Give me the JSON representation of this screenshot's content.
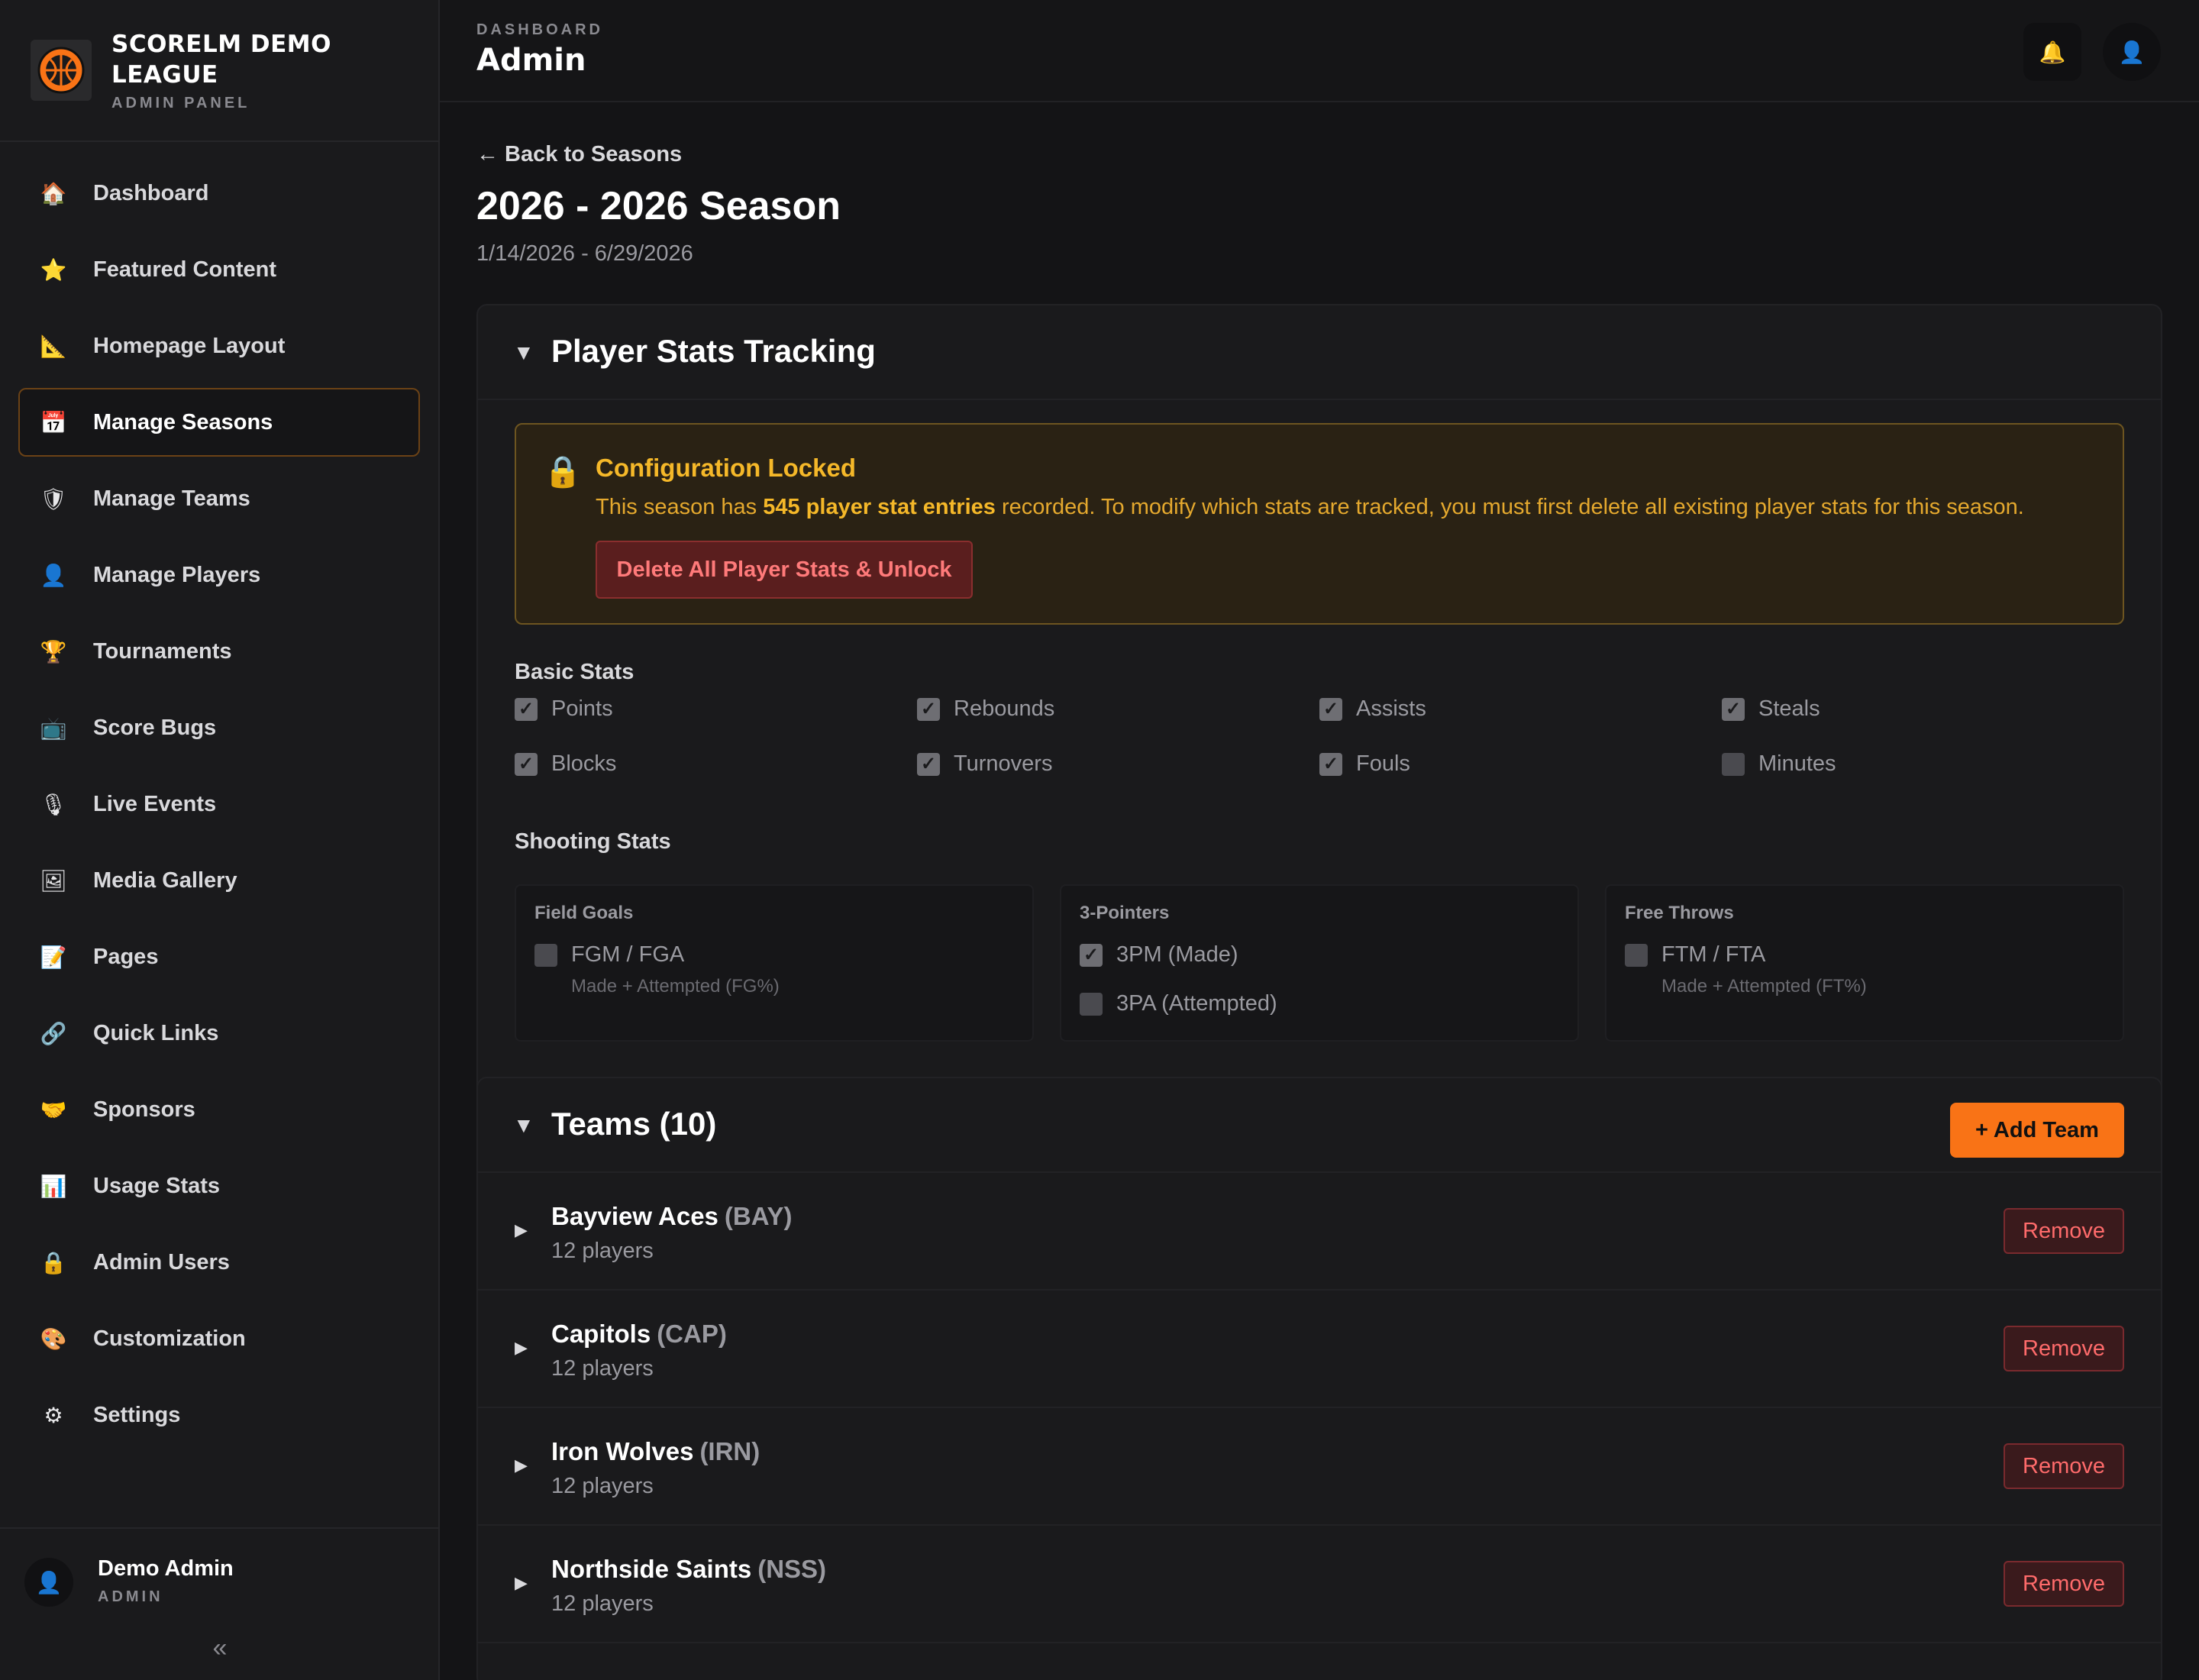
{
  "brand": {
    "name": "SCORELM DEMO LEAGUE",
    "subtitle": "ADMIN PANEL",
    "logo_icon": "basketball-logo"
  },
  "nav": [
    {
      "label": "Dashboard",
      "icon": "🏠",
      "active": false
    },
    {
      "label": "Featured Content",
      "icon": "⭐",
      "active": false
    },
    {
      "label": "Homepage Layout",
      "icon": "📐",
      "active": false
    },
    {
      "label": "Manage Seasons",
      "icon": "📅",
      "active": true
    },
    {
      "label": "Manage Teams",
      "icon": "🛡",
      "active": false
    },
    {
      "label": "Manage Players",
      "icon": "👤",
      "active": false
    },
    {
      "label": "Tournaments",
      "icon": "🏆",
      "active": false
    },
    {
      "label": "Score Bugs",
      "icon": "📺",
      "active": false
    },
    {
      "label": "Live Events",
      "icon": "🎙",
      "active": false
    },
    {
      "label": "Media Gallery",
      "icon": "🖼",
      "active": false
    },
    {
      "label": "Pages",
      "icon": "📝",
      "active": false
    },
    {
      "label": "Quick Links",
      "icon": "🔗",
      "active": false
    },
    {
      "label": "Sponsors",
      "icon": "🤝",
      "active": false
    },
    {
      "label": "Usage Stats",
      "icon": "📊",
      "active": false
    },
    {
      "label": "Admin Users",
      "icon": "🔒",
      "active": false
    },
    {
      "label": "Customization",
      "icon": "🎨",
      "active": false
    },
    {
      "label": "Settings",
      "icon": "⚙",
      "active": false
    }
  ],
  "user": {
    "name": "Demo Admin",
    "role": "ADMIN",
    "avatar_icon": "👤",
    "collapse_icon": "«"
  },
  "topbar": {
    "crumb": "DASHBOARD",
    "title": "Admin",
    "bell_icon": "🔔",
    "profile_icon": "👤"
  },
  "page": {
    "back_label": "← Back to Seasons",
    "title": "2026 - 2026 Season",
    "dates": "1/14/2026 - 6/29/2026"
  },
  "stats_card": {
    "caret": "▼",
    "title": "Player Stats Tracking",
    "lock": {
      "icon": "🔒",
      "title": "Configuration Locked",
      "msg_pre": "This season has ",
      "msg_bold": "545 player stat entries",
      "msg_post": " recorded. To modify which stats are tracked, you must first delete all existing player stats for this season.",
      "button": "Delete All Player Stats & Unlock"
    },
    "basic_label": "Basic Stats",
    "basic_rows": [
      [
        {
          "label": "Points",
          "checked": true
        },
        {
          "label": "Rebounds",
          "checked": true
        },
        {
          "label": "Assists",
          "checked": true
        },
        {
          "label": "Steals",
          "checked": true
        }
      ],
      [
        {
          "label": "Blocks",
          "checked": true
        },
        {
          "label": "Turnovers",
          "checked": true
        },
        {
          "label": "Fouls",
          "checked": true
        },
        {
          "label": "Minutes",
          "checked": false
        }
      ]
    ],
    "shooting_label": "Shooting Stats",
    "shooting": [
      {
        "title": "Field Goals",
        "options": [
          {
            "label": "FGM / FGA",
            "checked": false,
            "hint": "Made + Attempted (FG%)"
          }
        ]
      },
      {
        "title": "3-Pointers",
        "options": [
          {
            "label": "3PM (Made)",
            "checked": true,
            "hint": ""
          },
          {
            "label": "3PA (Attempted)",
            "checked": false,
            "hint": ""
          }
        ]
      },
      {
        "title": "Free Throws",
        "options": [
          {
            "label": "FTM / FTA",
            "checked": false,
            "hint": "Made + Attempted (FT%)"
          }
        ]
      }
    ]
  },
  "teams_card": {
    "caret": "▼",
    "title": "Teams (10)",
    "add_button": "+ Add Team",
    "row_caret": "▶",
    "remove_label": "Remove",
    "teams": [
      {
        "name": "Bayview Aces",
        "abbr": "(BAY)",
        "players": "12 players"
      },
      {
        "name": "Capitols",
        "abbr": "(CAP)",
        "players": "12 players"
      },
      {
        "name": "Iron Wolves",
        "abbr": "(IRN)",
        "players": "12 players"
      },
      {
        "name": "Northside Saints",
        "abbr": "(NSS)",
        "players": "12 players"
      }
    ]
  },
  "colors": {
    "accent": "#f97316",
    "warning": "#f5b829",
    "danger": "#ff6b6b"
  }
}
